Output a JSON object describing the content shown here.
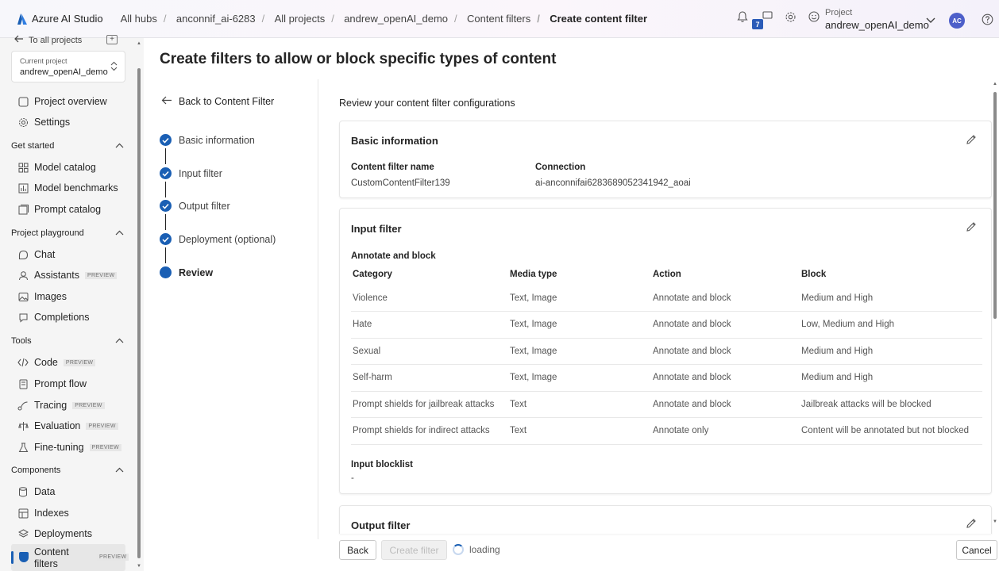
{
  "app": {
    "name": "Azure AI Studio"
  },
  "breadcrumbs": [
    "All hubs",
    "anconnif_ai-6283",
    "All projects",
    "andrew_openAI_demo",
    "Content filters",
    "Create content filter"
  ],
  "topbar": {
    "notification_count": "7",
    "project_label": "Project",
    "project_value": "andrew_openAI_demo",
    "avatar_initials": "AC"
  },
  "sidebar": {
    "back_label": "To all projects",
    "current_project_label": "Current project",
    "current_project_value": "andrew_openAI_demo",
    "items": {
      "project_overview": "Project overview",
      "settings": "Settings",
      "model_catalog": "Model catalog",
      "model_benchmarks": "Model benchmarks",
      "prompt_catalog": "Prompt catalog",
      "chat": "Chat",
      "assistants": "Assistants",
      "images": "Images",
      "completions": "Completions",
      "code": "Code",
      "prompt_flow": "Prompt flow",
      "tracing": "Tracing",
      "evaluation": "Evaluation",
      "fine_tuning": "Fine-tuning",
      "data": "Data",
      "indexes": "Indexes",
      "deployments": "Deployments",
      "content_filters_line1": "Content",
      "content_filters_line2": "filters"
    },
    "sections": {
      "get_started": "Get started",
      "project_playground": "Project playground",
      "tools": "Tools",
      "components": "Components"
    },
    "preview_tag": "PREVIEW"
  },
  "main": {
    "title": "Create filters to allow or block specific types of content",
    "back_link": "Back to Content Filter",
    "steps": [
      "Basic information",
      "Input filter",
      "Output filter",
      "Deployment (optional)",
      "Review"
    ],
    "review_heading": "Review your content filter configurations",
    "basic_info": {
      "heading": "Basic information",
      "name_label": "Content filter name",
      "name_value": "CustomContentFilter139",
      "connection_label": "Connection",
      "connection_value": "ai-anconnifai6283689052341942_aoai"
    },
    "input_filter": {
      "heading": "Input filter",
      "subheading": "Annotate and block",
      "columns": [
        "Category",
        "Media type",
        "Action",
        "Block"
      ],
      "rows": [
        [
          "Violence",
          "Text, Image",
          "Annotate and block",
          "Medium and High"
        ],
        [
          "Hate",
          "Text, Image",
          "Annotate and block",
          "Low, Medium and High"
        ],
        [
          "Sexual",
          "Text, Image",
          "Annotate and block",
          "Medium and High"
        ],
        [
          "Self-harm",
          "Text, Image",
          "Annotate and block",
          "Medium and High"
        ],
        [
          "Prompt shields for jailbreak attacks",
          "Text",
          "Annotate and block",
          "Jailbreak attacks will be blocked"
        ],
        [
          "Prompt shields for indirect attacks",
          "Text",
          "Annotate only",
          "Content will be annotated but not blocked"
        ]
      ],
      "blocklist_label": "Input blocklist",
      "blocklist_value": "-"
    },
    "output_filter": {
      "heading": "Output filter"
    },
    "footer": {
      "back": "Back",
      "create": "Create filter",
      "loading": "loading",
      "cancel": "Cancel"
    }
  },
  "colors": {
    "accent": "#1a5fb4",
    "avatar": "#4d5fc9"
  }
}
